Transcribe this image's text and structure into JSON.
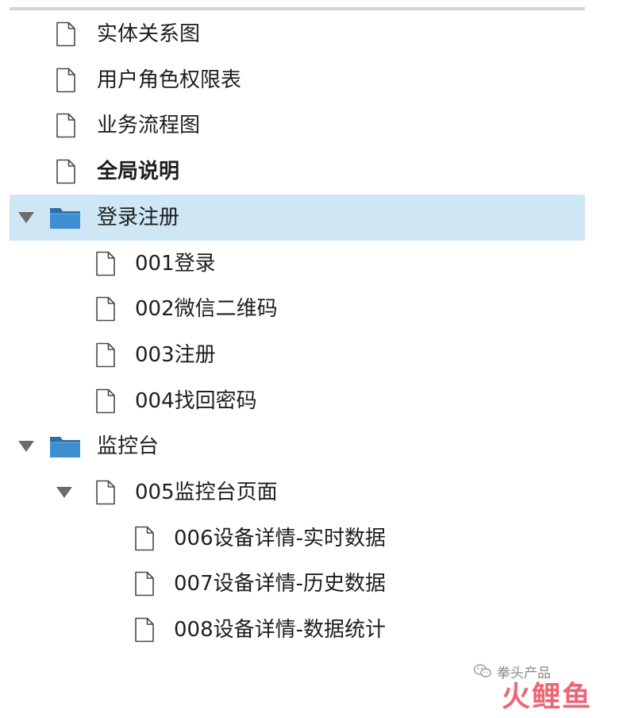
{
  "colors": {
    "selection": "#cfe6f5",
    "folder": "#3d8fd1",
    "text": "#1e1e1e",
    "watermark_red": "#e8334a"
  },
  "tree": {
    "items": [
      {
        "label": "实体关系图",
        "icon": "page-icon",
        "level": 1,
        "bold": false,
        "selected": false,
        "expanded": null
      },
      {
        "label": "用户角色权限表",
        "icon": "page-icon",
        "level": 1,
        "bold": false,
        "selected": false,
        "expanded": null
      },
      {
        "label": "业务流程图",
        "icon": "page-icon",
        "level": 1,
        "bold": false,
        "selected": false,
        "expanded": null
      },
      {
        "label": "全局说明",
        "icon": "page-icon",
        "level": 1,
        "bold": true,
        "selected": false,
        "expanded": null
      },
      {
        "label": "登录注册",
        "icon": "folder-icon",
        "level": 0,
        "bold": false,
        "selected": true,
        "expanded": true
      },
      {
        "label": "001登录",
        "icon": "page-icon",
        "level": 2,
        "bold": false,
        "selected": false,
        "expanded": null
      },
      {
        "label": "002微信二维码",
        "icon": "page-icon",
        "level": 2,
        "bold": false,
        "selected": false,
        "expanded": null
      },
      {
        "label": "003注册",
        "icon": "page-icon",
        "level": 2,
        "bold": false,
        "selected": false,
        "expanded": null
      },
      {
        "label": "004找回密码",
        "icon": "page-icon",
        "level": 2,
        "bold": false,
        "selected": false,
        "expanded": null
      },
      {
        "label": "监控台",
        "icon": "folder-icon",
        "level": 0,
        "bold": false,
        "selected": false,
        "expanded": true
      },
      {
        "label": "005监控台页面",
        "icon": "page-icon",
        "level": 2,
        "bold": false,
        "selected": false,
        "expanded": true
      },
      {
        "label": "006设备详情-实时数据",
        "icon": "page-icon",
        "level": 3,
        "bold": false,
        "selected": false,
        "expanded": null
      },
      {
        "label": "007设备详情-历史数据",
        "icon": "page-icon",
        "level": 3,
        "bold": false,
        "selected": false,
        "expanded": null
      },
      {
        "label": "008设备详情-数据统计",
        "icon": "page-icon",
        "level": 3,
        "bold": false,
        "selected": false,
        "expanded": null
      }
    ]
  },
  "watermark": {
    "caption": "拳头产品",
    "brand": "火鲤鱼",
    "icon": "wechat-icon"
  }
}
